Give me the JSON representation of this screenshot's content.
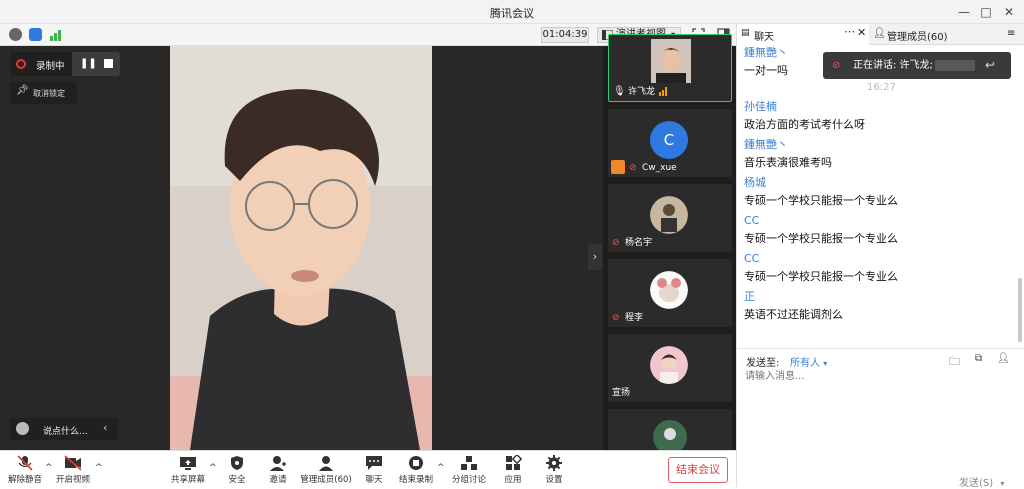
{
  "window": {
    "title": "腾讯会议",
    "minimize": "—",
    "maximize": "□",
    "close": "✕"
  },
  "toolbar": {
    "timer": "01:04:39",
    "view_label": "演讲者视图"
  },
  "stage": {
    "recording_label": "录制中",
    "unpin_label": "取消锁定",
    "reaction_label": "说点什么..."
  },
  "participants": [
    {
      "name": "许飞龙"
    },
    {
      "name": "Cw_xue",
      "initial": "C"
    },
    {
      "name": "杨名宇"
    },
    {
      "name": "程李"
    },
    {
      "name": "宣扬"
    }
  ],
  "bottombar": {
    "mute": "解除静音",
    "video": "开启视频",
    "share": "共享屏幕",
    "security": "安全",
    "invite": "邀请",
    "members": "管理成员(60)",
    "chat": "聊天",
    "end_record": "结束录制",
    "breakout": "分组讨论",
    "apps": "应用",
    "settings": "设置",
    "end_meeting": "结束会议"
  },
  "side": {
    "tab_chat": "聊天",
    "tab_members": "管理成员(60)",
    "speaking": "正在讲话: 许飞龙;",
    "timestamp": "16:27",
    "messages": [
      {
        "sender": "鍾無艷丶",
        "text": "一对一吗"
      },
      {
        "sender": "孙佳楠",
        "text": "政治方面的考试考什么呀"
      },
      {
        "sender": "鍾無艷丶",
        "text": "音乐表演很难考吗"
      },
      {
        "sender": "杨城",
        "text": "专硕一个学校只能报一个专业么"
      },
      {
        "sender": "CC",
        "text": "专硕一个学校只能报一个专业么"
      },
      {
        "sender": "CC",
        "text": "专硕一个学校只能报一个专业么"
      },
      {
        "sender": "正",
        "text": "英语不过还能调剂么"
      }
    ],
    "send_to_label": "发送至:",
    "send_to_value": "所有人",
    "input_placeholder": "请输入消息...",
    "send_button": "发送(S)"
  },
  "colors": {
    "accent": "#3b7fd6",
    "danger": "#e03e3e",
    "stage_bg": "#2a2827"
  }
}
